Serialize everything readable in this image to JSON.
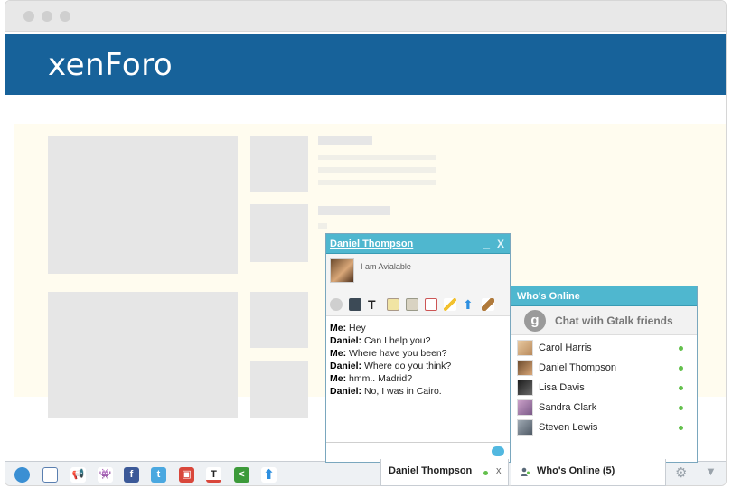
{
  "site": {
    "logo": "xenForo"
  },
  "taskbar": {
    "icons": [
      "info-icon",
      "video-icon",
      "megaphone-icon",
      "invader-icon",
      "facebook-icon",
      "twitter-icon",
      "flag-icon",
      "text-icon",
      "share-icon",
      "upload-icon"
    ]
  },
  "chat": {
    "title": "Daniel Thompson",
    "minimize": "_",
    "close": "X",
    "status_message": "I am Avialable",
    "tools": [
      "smiley-icon",
      "monitor-icon",
      "font-icon",
      "note-icon",
      "files-icon",
      "card-icon",
      "pencil-icon",
      "upload-icon",
      "brush-icon"
    ],
    "messages": [
      {
        "sender": "Me:",
        "text": "Hey"
      },
      {
        "sender": "Daniel:",
        "text": "Can I help you?"
      },
      {
        "sender": "Me:",
        "text": "Where have you been?"
      },
      {
        "sender": "Daniel:",
        "text": "Where do you think?"
      },
      {
        "sender": "Me:",
        "text": "hmm.. Madrid?"
      },
      {
        "sender": "Daniel:",
        "text": "No, I was in Cairo."
      }
    ]
  },
  "online": {
    "title": "Who's Online",
    "gtalk_label": "Chat with Gtalk friends",
    "friends": [
      "Carol Harris",
      "Daniel Thompson",
      "Lisa Davis",
      "Sandra Clark",
      "Steven Lewis"
    ]
  },
  "tabs": {
    "chat_name": "Daniel Thompson",
    "chat_close": "x",
    "online_label": "Who's Online (5)"
  }
}
